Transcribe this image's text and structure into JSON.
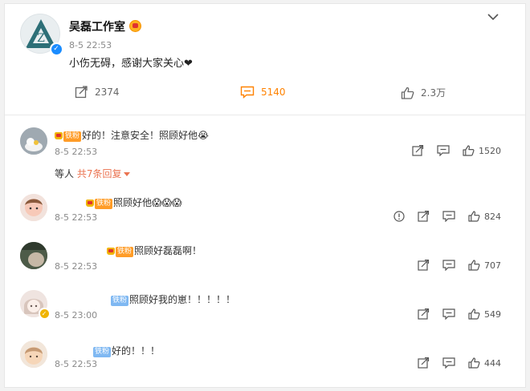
{
  "post": {
    "author": "吴磊工作室",
    "time": "8-5 22:53",
    "text": "小伤无碍，感谢大家关心❤",
    "reposts": "2374",
    "comments": "5140",
    "likes": "2.3万"
  },
  "badge_labels": {
    "hot": "铁粉",
    "cool": "铁粉"
  },
  "comments": [
    {
      "text": "好的！注意安全！照顾好他😭",
      "time": "8-5 22:53",
      "likes": "1520"
    },
    {
      "text": "照顾好他😱😱😱",
      "time": "8-5 22:53",
      "likes": "824"
    },
    {
      "text": "照顾好磊磊啊！",
      "time": "8-5 22:53",
      "likes": "707"
    },
    {
      "text": "照顾好我的崽！！！！！",
      "time": "8-5 23:00",
      "likes": "549"
    },
    {
      "text": "好的！！！",
      "time": "8-5 22:53",
      "likes": "444"
    }
  ],
  "replies": {
    "prefix": "等人",
    "link": "共7条回复"
  },
  "colors": {
    "accent": "#ff8200",
    "name": "#eb7350",
    "verified": "#1a8cff",
    "badge_hot": "#ff9c27",
    "badge_cool": "#7fb8f2"
  }
}
